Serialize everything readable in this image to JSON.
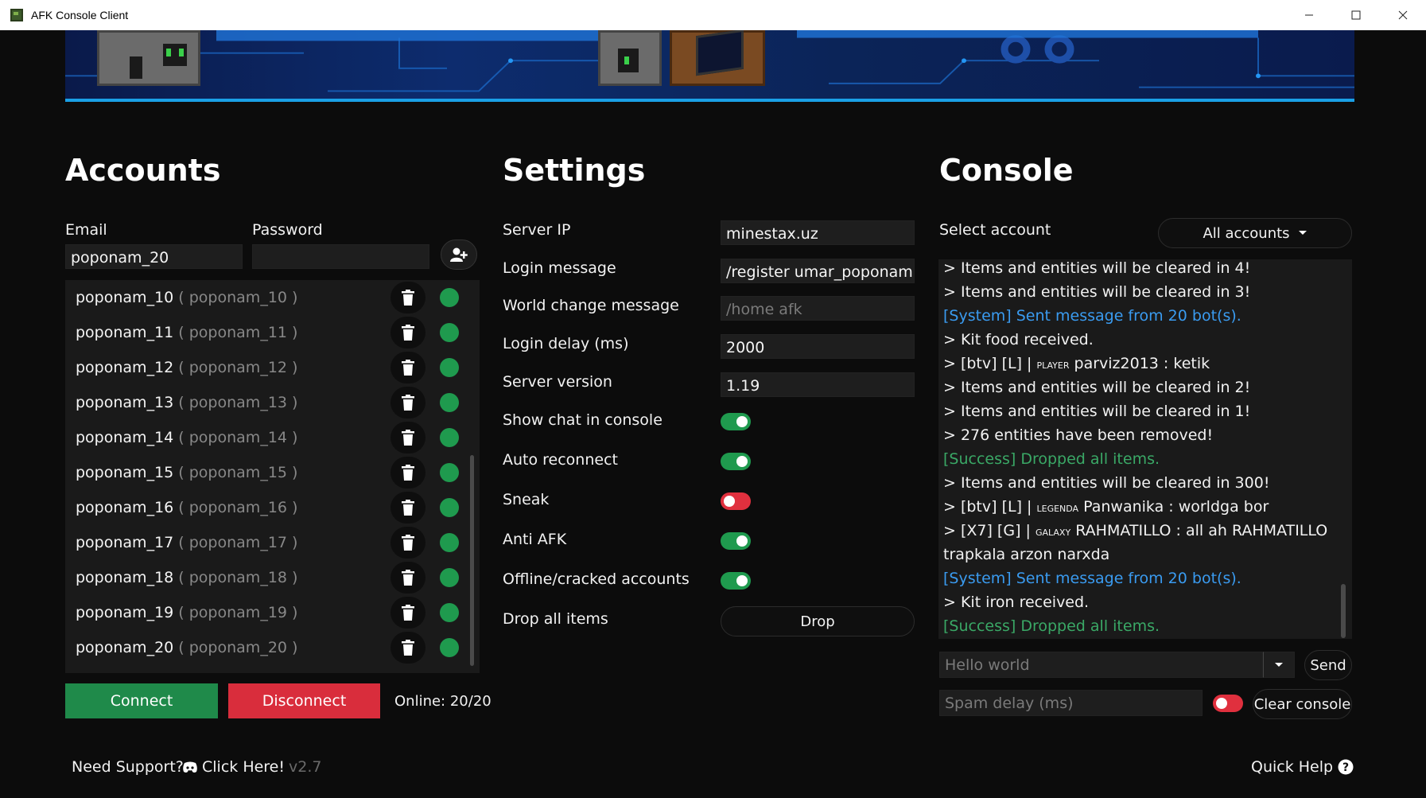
{
  "window": {
    "title": "AFK Console Client"
  },
  "accounts": {
    "heading": "Accounts",
    "email_label": "Email",
    "password_label": "Password",
    "email_value": "poponam_20",
    "password_value": "",
    "list": [
      {
        "name": "poponam_10",
        "sub": "( poponam_10 )"
      },
      {
        "name": "poponam_11",
        "sub": "( poponam_11 )"
      },
      {
        "name": "poponam_12",
        "sub": "( poponam_12 )"
      },
      {
        "name": "poponam_13",
        "sub": "( poponam_13 )"
      },
      {
        "name": "poponam_14",
        "sub": "( poponam_14 )"
      },
      {
        "name": "poponam_15",
        "sub": "( poponam_15 )"
      },
      {
        "name": "poponam_16",
        "sub": "( poponam_16 )"
      },
      {
        "name": "poponam_17",
        "sub": "( poponam_17 )"
      },
      {
        "name": "poponam_18",
        "sub": "( poponam_18 )"
      },
      {
        "name": "poponam_19",
        "sub": "( poponam_19 )"
      },
      {
        "name": "poponam_20",
        "sub": "( poponam_20 )"
      }
    ],
    "connect_label": "Connect",
    "disconnect_label": "Disconnect",
    "online_text": "Online: 20/20"
  },
  "settings": {
    "heading": "Settings",
    "server_ip_label": "Server IP",
    "server_ip_value": "minestax.uz",
    "login_message_label": "Login message",
    "login_message_value": "/register umar_poponam u",
    "world_change_label": "World change message",
    "world_change_placeholder": "/home afk",
    "login_delay_label": "Login delay (ms)",
    "login_delay_value": "2000",
    "server_version_label": "Server version",
    "server_version_value": "1.19",
    "show_chat_label": "Show chat in console",
    "auto_reconnect_label": "Auto reconnect",
    "sneak_label": "Sneak",
    "anti_afk_label": "Anti AFK",
    "offline_label": "Offline/cracked accounts",
    "drop_label": "Drop all items",
    "drop_button": "Drop"
  },
  "toggles": {
    "show_chat": true,
    "auto_reconnect": true,
    "sneak": false,
    "anti_afk": true,
    "offline": true,
    "spam": false
  },
  "console": {
    "heading": "Console",
    "select_label": "Select account",
    "select_value": "All accounts",
    "lines": [
      {
        "text": "> Items and entities will be cleared in 4!",
        "kind": "normal"
      },
      {
        "text": "> Items and entities will be cleared in 3!",
        "kind": "normal"
      },
      {
        "text": "[System] Sent message from 20 bot(s).",
        "kind": "system"
      },
      {
        "text": "> Kit food received.",
        "kind": "normal"
      },
      {
        "pre": "> [btv] [L] | ",
        "rank": "player",
        "post": " parviz2013 : ketik",
        "kind": "normal"
      },
      {
        "text": "> Items and entities will be cleared in 2!",
        "kind": "normal"
      },
      {
        "text": "> Items and entities will be cleared in 1!",
        "kind": "normal"
      },
      {
        "text": "> 276 entities have been removed!",
        "kind": "normal"
      },
      {
        "text": "[Success] Dropped all items.",
        "kind": "success"
      },
      {
        "text": "> Items and entities will be cleared in 300!",
        "kind": "normal"
      },
      {
        "pre": "> [btv] [L] | ",
        "rank": "legenda",
        "post": " Panwanika : worldga bor",
        "kind": "normal"
      },
      {
        "pre": "> [X7] [G] | ",
        "rank": "galaxy",
        "post": " RAHMATILLO : all ah RAHMATILLO",
        "kind": "normal"
      },
      {
        "text": "trapkala arzon narxda",
        "kind": "normal"
      },
      {
        "text": "[System] Sent message from 20 bot(s).",
        "kind": "system"
      },
      {
        "text": "> Kit iron received.",
        "kind": "normal"
      },
      {
        "text": "[Success] Dropped all items.",
        "kind": "success"
      }
    ],
    "message_placeholder": "Hello world",
    "send_label": "Send",
    "spam_placeholder": "Spam delay (ms)",
    "clear_label": "Clear console"
  },
  "footer": {
    "support_text": "Need Support?",
    "click_here": "Click Here!",
    "version": "v2.7",
    "quick_help": "Quick Help"
  },
  "colors": {
    "green": "#1f9a4e",
    "red": "#e0303e",
    "system_blue": "#3a9bf0",
    "success_green": "#3aa866"
  }
}
